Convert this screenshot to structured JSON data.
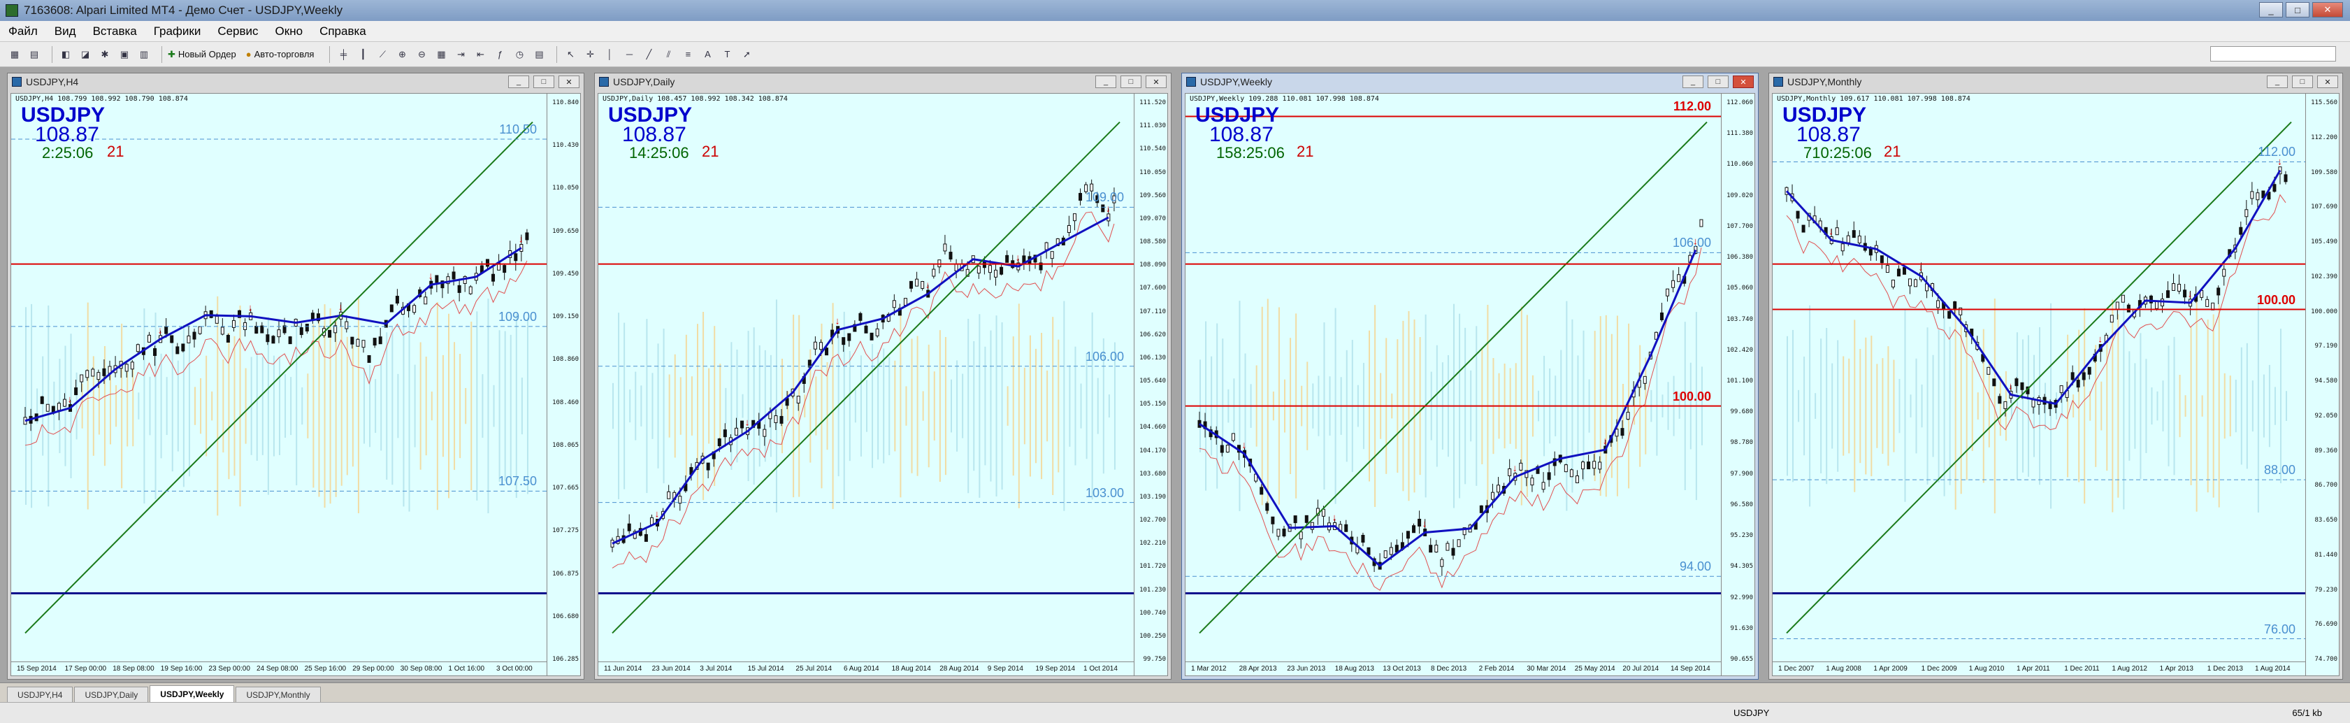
{
  "window": {
    "title": "7163608: Alpari Limited MT4 - Демо Счет - USDJPY,Weekly"
  },
  "menu": [
    "Файл",
    "Вид",
    "Вставка",
    "Графики",
    "Сервис",
    "Окно",
    "Справка"
  ],
  "toolbar": {
    "new_order": "Новый Ордер",
    "auto_trading": "Авто-торговля"
  },
  "charts": [
    {
      "title": "USDJPY,H4",
      "info": "USDJPY,H4  108.799 108.992 108.790 108.874",
      "symbol": "USDJPY",
      "price": "108.87",
      "timer": "2:25:06",
      "spread": "21",
      "yticks": [
        "110.840",
        "110.430",
        "110.050",
        "109.650",
        "109.450",
        "109.150",
        "108.860",
        "108.460",
        "108.065",
        "107.665",
        "107.275",
        "106.875",
        "106.680",
        "106.285"
      ],
      "xticks": [
        "15 Sep 2014",
        "17 Sep 00:00",
        "18 Sep 08:00",
        "19 Sep 16:00",
        "23 Sep 00:00",
        "24 Sep 08:00",
        "25 Sep 16:00",
        "29 Sep 00:00",
        "30 Sep 08:00",
        "1 Oct 16:00",
        "3 Oct 00:00"
      ],
      "levels": [
        "110.50",
        "109.00",
        "107.50"
      ]
    },
    {
      "title": "USDJPY,Daily",
      "info": "USDJPY,Daily  108.457 108.992 108.342 108.874",
      "symbol": "USDJPY",
      "price": "108.87",
      "timer": "14:25:06",
      "spread": "21",
      "yticks": [
        "111.520",
        "111.030",
        "110.540",
        "110.050",
        "109.560",
        "109.070",
        "108.580",
        "108.090",
        "107.600",
        "107.110",
        "106.620",
        "106.130",
        "105.640",
        "105.150",
        "104.660",
        "104.170",
        "103.680",
        "103.190",
        "102.700",
        "102.210",
        "101.720",
        "101.230",
        "100.740",
        "100.250",
        "99.750"
      ],
      "xticks": [
        "11 Jun 2014",
        "23 Jun 2014",
        "3 Jul 2014",
        "15 Jul 2014",
        "25 Jul 2014",
        "6 Aug 2014",
        "18 Aug 2014",
        "28 Aug 2014",
        "9 Sep 2014",
        "19 Sep 2014",
        "1 Oct 2014"
      ],
      "levels": [
        "109.00",
        "106.00",
        "103.00"
      ]
    },
    {
      "title": "USDJPY,Weekly",
      "info": "USDJPY,Weekly  109.288 110.081 107.998 108.874",
      "symbol": "USDJPY",
      "price": "108.87",
      "timer": "158:25:06",
      "spread": "21",
      "yticks": [
        "112.060",
        "111.380",
        "110.060",
        "109.020",
        "107.700",
        "106.380",
        "105.060",
        "103.740",
        "102.420",
        "101.100",
        "99.680",
        "98.780",
        "97.900",
        "96.580",
        "95.230",
        "94.305",
        "92.990",
        "91.630",
        "90.655"
      ],
      "xticks": [
        "1 Mar 2012",
        "28 Apr 2013",
        "23 Jun 2013",
        "18 Aug 2013",
        "13 Oct 2013",
        "8 Dec 2013",
        "2 Feb 2014",
        "30 Mar 2014",
        "25 May 2014",
        "20 Jul 2014",
        "14 Sep 2014"
      ],
      "levels": [
        "112.00",
        "106.00",
        "100.00",
        "94.00"
      ]
    },
    {
      "title": "USDJPY,Monthly",
      "info": "USDJPY,Monthly  109.617 110.081 107.998 108.874",
      "symbol": "USDJPY",
      "price": "108.87",
      "timer": "710:25:06",
      "spread": "21",
      "yticks": [
        "115.560",
        "112.200",
        "109.580",
        "107.690",
        "105.490",
        "102.390",
        "100.000",
        "97.190",
        "94.580",
        "92.050",
        "89.360",
        "86.700",
        "83.650",
        "81.440",
        "79.230",
        "76.690",
        "74.700"
      ],
      "xticks": [
        "1 Dec 2007",
        "1 Aug 2008",
        "1 Apr 2009",
        "1 Dec 2009",
        "1 Aug 2010",
        "1 Apr 2011",
        "1 Dec 2011",
        "1 Aug 2012",
        "1 Apr 2013",
        "1 Dec 2013",
        "1 Aug 2014"
      ],
      "levels": [
        "112.00",
        "100.00",
        "88.00",
        "76.00"
      ]
    }
  ],
  "tabs": [
    "USDJPY,H4",
    "USDJPY,Daily",
    "USDJPY,Weekly",
    "USDJPY,Monthly"
  ],
  "status": {
    "symbol": "USDJPY",
    "traffic": "65/1 kb"
  }
}
